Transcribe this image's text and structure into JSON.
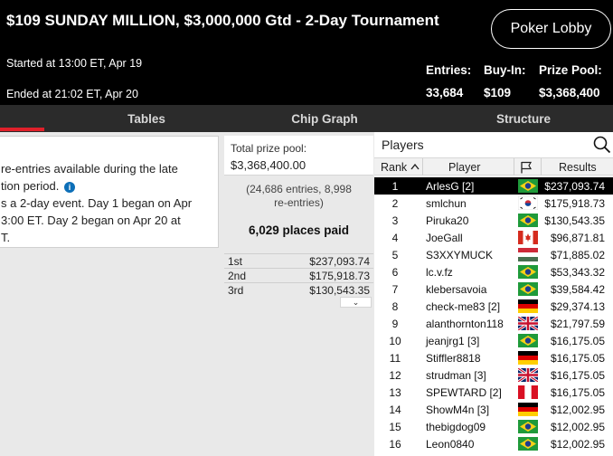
{
  "header": {
    "title": "$109 SUNDAY MILLION, $3,000,000 Gtd - 2-Day Tournament",
    "started": "Started at 13:00 ET, Apr 19",
    "ended": "Ended at 21:02 ET, Apr 20",
    "lobby_button": "Poker Lobby",
    "entries_label": "Entries:",
    "entries_value": "33,684",
    "buyin_label": "Buy-In:",
    "buyin_value": "$109",
    "prizepool_label": "Prize Pool:",
    "prizepool_value": "$3,368,400"
  },
  "tabs": [
    {
      "label": ""
    },
    {
      "label": "Tables"
    },
    {
      "label": "Chip Graph"
    },
    {
      "label": "Structure"
    }
  ],
  "info": {
    "line1": "re-entries available during the late",
    "line2": "tion period.",
    "line3": "s a 2-day event. Day 1 began on Apr",
    "line4": "3:00 ET. Day 2 began on Apr 20 at",
    "line5": "T.",
    "info_glyph": "i"
  },
  "prize": {
    "pool_label": "Total prize pool:",
    "pool_value": "$3,368,400.00",
    "entries_line1": "(24,686 entries, 8,998",
    "entries_line2": "re-entries)",
    "places_paid": "6,029 places paid",
    "payouts": [
      {
        "place": "1st",
        "amount": "$237,093.74"
      },
      {
        "place": "2nd",
        "amount": "$175,918.73"
      },
      {
        "place": "3rd",
        "amount": "$130,543.35"
      }
    ],
    "more_glyph": "⌄"
  },
  "players": {
    "title": "Players",
    "columns": {
      "rank": "Rank",
      "player": "Player",
      "results": "Results"
    },
    "rows": [
      {
        "rank": "1",
        "player": "ArlesG [2]",
        "flag": "brazil",
        "result": "$237,093.74",
        "selected": true
      },
      {
        "rank": "2",
        "player": "smlchun",
        "flag": "south-korea",
        "result": "$175,918.73"
      },
      {
        "rank": "3",
        "player": "Piruka20",
        "flag": "brazil",
        "result": "$130,543.35"
      },
      {
        "rank": "4",
        "player": "JoeGall",
        "flag": "canada",
        "result": "$96,871.81"
      },
      {
        "rank": "5",
        "player": "S3XXYMUCK",
        "flag": "hungary",
        "result": "$71,885.02"
      },
      {
        "rank": "6",
        "player": "lc.v.fz",
        "flag": "brazil",
        "result": "$53,343.32"
      },
      {
        "rank": "7",
        "player": "klebersavoia",
        "flag": "brazil",
        "result": "$39,584.42"
      },
      {
        "rank": "8",
        "player": "check-me83 [2]",
        "flag": "germany",
        "result": "$29,374.13"
      },
      {
        "rank": "9",
        "player": "alanthornton118",
        "flag": "uk",
        "result": "$21,797.59"
      },
      {
        "rank": "10",
        "player": "jeanjrg1 [3]",
        "flag": "brazil",
        "result": "$16,175.05"
      },
      {
        "rank": "11",
        "player": "Stiffler8818",
        "flag": "germany",
        "result": "$16,175.05"
      },
      {
        "rank": "12",
        "player": "strudman [3]",
        "flag": "uk",
        "result": "$16,175.05"
      },
      {
        "rank": "13",
        "player": "SPEWTARD [2]",
        "flag": "peru",
        "result": "$16,175.05"
      },
      {
        "rank": "14",
        "player": "ShowM4n [3]",
        "flag": "germany",
        "result": "$12,002.95"
      },
      {
        "rank": "15",
        "player": "thebigdog09",
        "flag": "brazil",
        "result": "$12,002.95"
      },
      {
        "rank": "16",
        "player": "Leon0840",
        "flag": "brazil",
        "result": "$12,002.95"
      }
    ]
  },
  "colors": {
    "header_bg": "#000000",
    "tab_bar_bg": "#2b2b2b",
    "active_tab_underline": "#e0202a",
    "selected_row_bg": "#000000",
    "info_icon": "#0d6fb8"
  }
}
